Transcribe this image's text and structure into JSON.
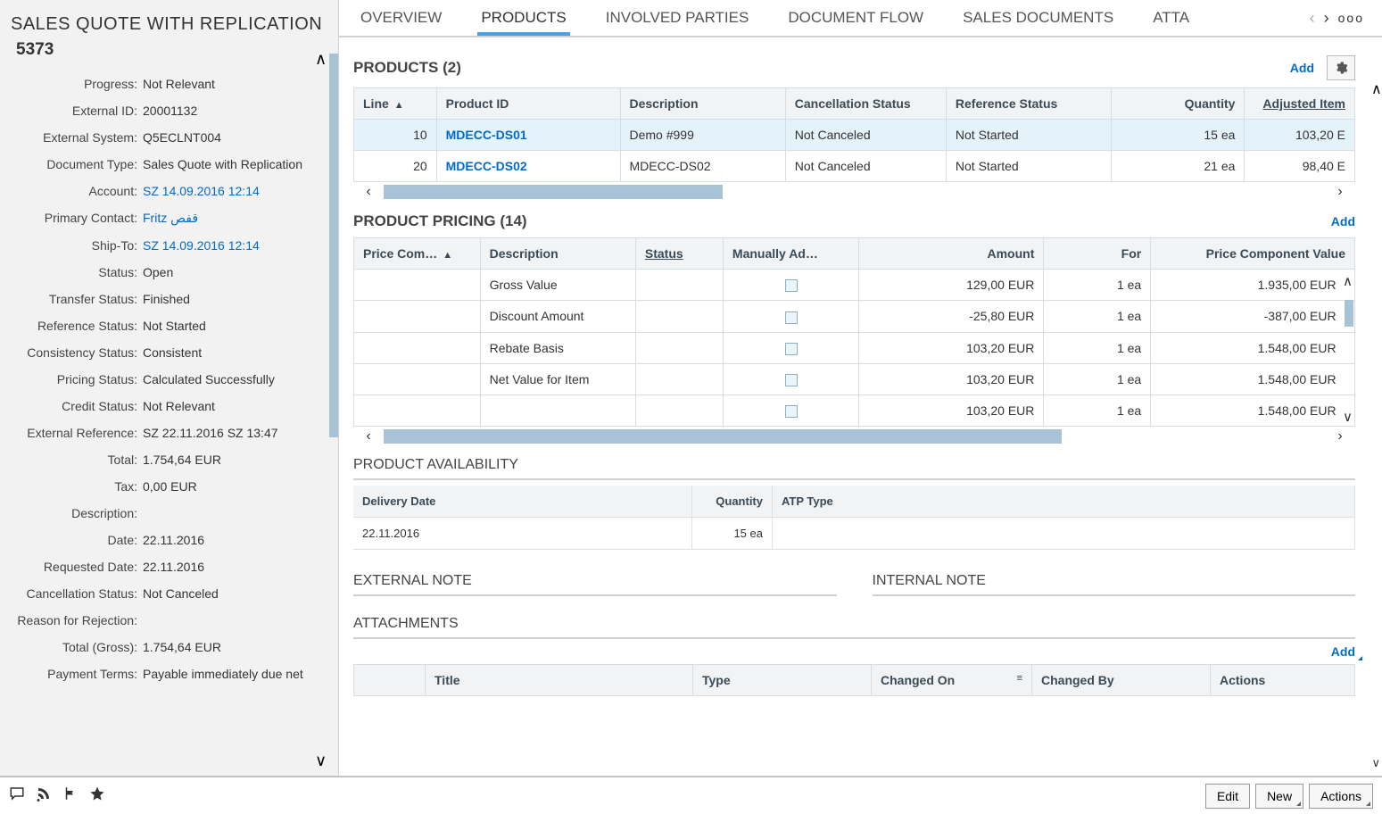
{
  "header": {
    "title": "SALES QUOTE WITH REPLICATION",
    "id": "5373"
  },
  "fields": [
    {
      "label": "Progress:",
      "value": "Not Relevant"
    },
    {
      "label": "External ID:",
      "value": "20001132"
    },
    {
      "label": "External System:",
      "value": "Q5ECLNT004"
    },
    {
      "label": "Document Type:",
      "value": "Sales Quote with Replication"
    },
    {
      "label": "Account:",
      "value": "SZ 14.09.2016 12:14",
      "link": true
    },
    {
      "label": "Primary Contact:",
      "value": "Fritz قفص",
      "link": true
    },
    {
      "label": "Ship-To:",
      "value": "SZ 14.09.2016 12:14",
      "link": true
    },
    {
      "label": "Status:",
      "value": "Open"
    },
    {
      "label": "Transfer Status:",
      "value": "Finished"
    },
    {
      "label": "Reference Status:",
      "value": "Not Started"
    },
    {
      "label": "Consistency Status:",
      "value": "Consistent"
    },
    {
      "label": "Pricing Status:",
      "value": "Calculated Successfully"
    },
    {
      "label": "Credit Status:",
      "value": "Not Relevant"
    },
    {
      "label": "External Reference:",
      "value": "SZ 22.11.2016 SZ 13:47"
    },
    {
      "label": "Total:",
      "value": "1.754,64 EUR"
    },
    {
      "label": "Tax:",
      "value": "0,00 EUR"
    },
    {
      "label": "Description:",
      "value": ""
    },
    {
      "label": "Date:",
      "value": "22.11.2016"
    },
    {
      "label": "Requested Date:",
      "value": "22.11.2016"
    },
    {
      "label": "Cancellation Status:",
      "value": "Not Canceled"
    },
    {
      "label": "Reason for Rejection:",
      "value": ""
    },
    {
      "label": "Total (Gross):",
      "value": "1.754,64 EUR"
    },
    {
      "label": "Payment Terms:",
      "value": "Payable immediately due net"
    }
  ],
  "tabs": {
    "items": [
      "OVERVIEW",
      "PRODUCTS",
      "INVOLVED PARTIES",
      "DOCUMENT FLOW",
      "SALES DOCUMENTS",
      "ATTA"
    ],
    "active": 1
  },
  "products": {
    "title": "PRODUCTS (2)",
    "add": "Add",
    "cols": [
      "Line",
      "Product ID",
      "Description",
      "Cancellation Status",
      "Reference Status",
      "Quantity",
      "Adjusted Item"
    ],
    "rows": [
      {
        "line": "10",
        "pid": "MDECC-DS01",
        "desc": "Demo #999",
        "cancel": "Not Canceled",
        "ref": "Not Started",
        "qty": "15 ea",
        "adj": "103,20 E",
        "selected": true
      },
      {
        "line": "20",
        "pid": "MDECC-DS02",
        "desc": "MDECC-DS02",
        "cancel": "Not Canceled",
        "ref": "Not Started",
        "qty": "21 ea",
        "adj": "98,40 E"
      }
    ]
  },
  "pricing": {
    "title": "PRODUCT PRICING (14)",
    "add": "Add",
    "cols": [
      "Price Com…",
      "Description",
      "Status",
      "Manually Ad…",
      "Amount",
      "For",
      "Price Component Value"
    ],
    "rows": [
      {
        "desc": "Gross Value",
        "amt": "129,00 EUR",
        "for": "1 ea",
        "pcv": "1.935,00",
        "cur": "EUR"
      },
      {
        "desc": "Discount Amount",
        "amt": "-25,80 EUR",
        "for": "1 ea",
        "pcv": "-387,00",
        "cur": "EUR"
      },
      {
        "desc": "Rebate Basis",
        "amt": "103,20 EUR",
        "for": "1 ea",
        "pcv": "1.548,00",
        "cur": "EUR"
      },
      {
        "desc": "Net Value for Item",
        "amt": "103,20 EUR",
        "for": "1 ea",
        "pcv": "1.548,00",
        "cur": "EUR"
      },
      {
        "desc": "",
        "amt": "103,20 EUR",
        "for": "1 ea",
        "pcv": "1.548,00",
        "cur": "EUR"
      }
    ]
  },
  "availability": {
    "title": "PRODUCT AVAILABILITY",
    "cols": [
      "Delivery Date",
      "Quantity",
      "ATP Type"
    ],
    "row": {
      "date": "22.11.2016",
      "qty": "15  ea",
      "atp": ""
    }
  },
  "external_note": "EXTERNAL NOTE",
  "internal_note": "INTERNAL NOTE",
  "attachments": {
    "title": "ATTACHMENTS",
    "add": "Add",
    "cols": [
      "Title",
      "Type",
      "Changed On",
      "Changed By",
      "Actions"
    ]
  },
  "footer": {
    "edit": "Edit",
    "new": "New",
    "actions": "Actions"
  }
}
